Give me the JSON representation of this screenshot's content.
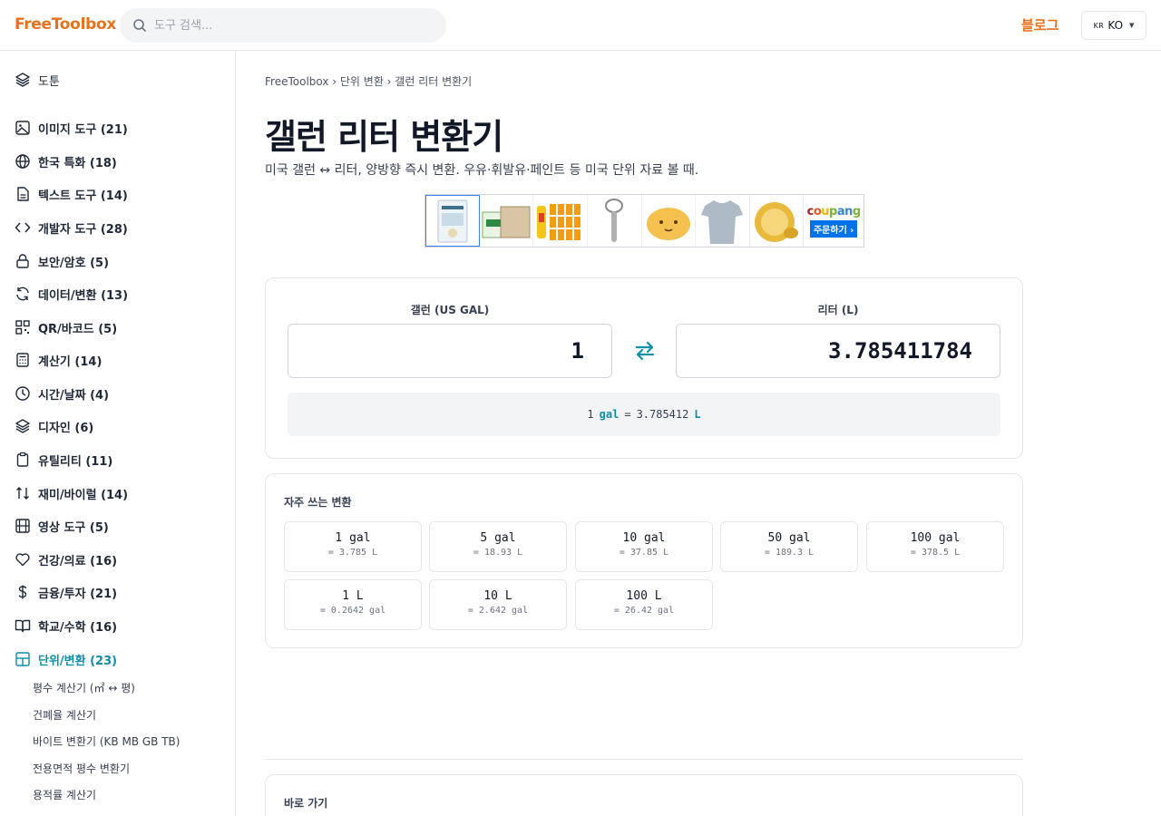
{
  "header": {
    "logo": "FreeToolbox",
    "search_placeholder": "도구 검색...",
    "blog": "블로그",
    "lang_flag": "KR",
    "lang": "KO"
  },
  "sidebar": {
    "top_item": "도툰",
    "categories": [
      {
        "label": "이미지 도구 (21)",
        "icon": "image-icon"
      },
      {
        "label": "한국 특화 (18)",
        "icon": "globe-icon"
      },
      {
        "label": "텍스트 도구 (14)",
        "icon": "document-icon"
      },
      {
        "label": "개발자 도구 (28)",
        "icon": "code-icon"
      },
      {
        "label": "보안/암호 (5)",
        "icon": "lock-icon"
      },
      {
        "label": "데이터/변환 (13)",
        "icon": "refresh-icon"
      },
      {
        "label": "QR/바코드 (5)",
        "icon": "qr-icon"
      },
      {
        "label": "계산기 (14)",
        "icon": "calculator-icon"
      },
      {
        "label": "시간/날짜 (4)",
        "icon": "clock-icon"
      },
      {
        "label": "디자인 (6)",
        "icon": "layers-icon"
      },
      {
        "label": "유틸리티 (11)",
        "icon": "clipboard-icon"
      },
      {
        "label": "재미/바이럴 (14)",
        "icon": "sort-icon"
      },
      {
        "label": "영상 도구 (5)",
        "icon": "film-icon"
      },
      {
        "label": "건강/의료 (16)",
        "icon": "heart-icon"
      },
      {
        "label": "금융/투자 (21)",
        "icon": "dollar-icon"
      },
      {
        "label": "학교/수학 (16)",
        "icon": "book-icon"
      },
      {
        "label": "단위/변환 (23)",
        "icon": "grid-icon"
      }
    ],
    "sub_items": [
      "평수 계산기 (㎡ ↔ 평)",
      "건폐율 계산기",
      "바이트 변환기 (KB MB GB TB)",
      "전용면적 평수 변환기",
      "용적률 계산기"
    ]
  },
  "breadcrumb": "FreeToolbox › 단위 변환 › 갤런 리터 변환기",
  "title": "갤런 리터 변환기",
  "description": "미국 갤런 ↔ 리터, 양방향 즉시 변환. 우유·휘발유·페인트 등 미국 단위 자료 볼 때.",
  "ad": {
    "brand": "coupang",
    "cta": "주문하기 ›",
    "brand_colors": [
      "#a0241b",
      "#ec5a24",
      "#f7b500",
      "#7bb03d",
      "#3a86c9"
    ]
  },
  "converter": {
    "left_label": "갤런 (US GAL)",
    "left_value": "1",
    "right_label": "리터 (L)",
    "right_value": "3.785411784",
    "formula": {
      "left_num": "1",
      "left_unit": "gal",
      "eq": "=",
      "right_num": "3.785412",
      "right_unit": "L"
    }
  },
  "frequent": {
    "title": "자주 쓰는 변환",
    "items": [
      {
        "value": "1 gal",
        "result": "= 3.785 L"
      },
      {
        "value": "5 gal",
        "result": "= 18.93 L"
      },
      {
        "value": "10 gal",
        "result": "= 37.85 L"
      },
      {
        "value": "50 gal",
        "result": "= 189.3 L"
      },
      {
        "value": "100 gal",
        "result": "= 378.5 L"
      },
      {
        "value": "1 L",
        "result": "= 0.2642 gal"
      },
      {
        "value": "10 L",
        "result": "= 2.642 gal"
      },
      {
        "value": "100 L",
        "result": "= 26.42 gal"
      }
    ]
  },
  "quick": {
    "title": "바로 가기"
  },
  "colors": {
    "accent": "#0e8fa8",
    "brand": "#e8711c"
  }
}
